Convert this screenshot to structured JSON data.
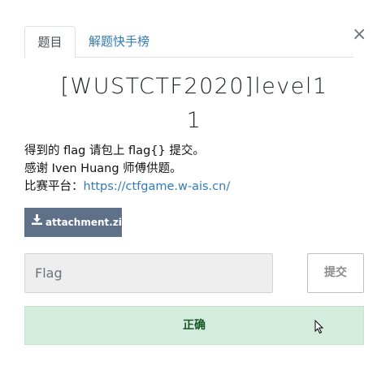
{
  "tabs": [
    {
      "label": "题目",
      "active": true
    },
    {
      "label": "解题快手榜",
      "active": false
    }
  ],
  "close_glyph": "×",
  "challenge": {
    "title_line1": "[WUSTCTF2020]level1",
    "title_line2": "1",
    "desc_line1": "得到的 flag 请包上 flag{} 提交。",
    "desc_line2": "感谢 Iven Huang 师傅供题。",
    "platform_label": "比赛平台：",
    "platform_link": "https://ctfgame.w-ais.cn/"
  },
  "attachment": {
    "label": "attachment.zip",
    "icon": "download-icon"
  },
  "flag_input": {
    "placeholder": "Flag",
    "value": ""
  },
  "submit_label": "提交",
  "result_text": "正确",
  "colors": {
    "link": "#337ab7",
    "attachment_bg": "#5e7189",
    "result_bg": "#d4ecdd",
    "result_text": "#155724"
  }
}
